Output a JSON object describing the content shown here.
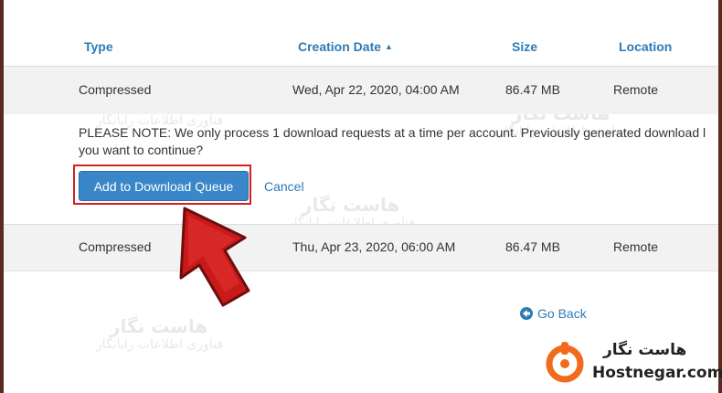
{
  "table": {
    "headers": {
      "type": "Type",
      "creation_date": "Creation Date",
      "size": "Size",
      "location": "Location"
    },
    "sort_indicator": "▲",
    "rows": [
      {
        "type": "Compressed",
        "creation_date": "Wed, Apr 22, 2020, 04:00 AM",
        "size": "86.47 MB",
        "location": "Remote"
      },
      {
        "type": "Compressed",
        "creation_date": "Thu, Apr 23, 2020, 06:00 AM",
        "size": "86.47 MB",
        "location": "Remote"
      }
    ]
  },
  "notice": {
    "line1": "PLEASE NOTE: We only process 1 download requests at a time per account. Previously generated download l",
    "line2": "you want to continue?",
    "add_button_label": "Add to Download Queue",
    "cancel_label": "Cancel"
  },
  "go_back_label": "Go Back",
  "watermark": {
    "title": "هاست نگار",
    "subtitle": "فناوری اطلاعات رایانگار"
  },
  "brand": {
    "name_fa": "هاست نگار",
    "name_en": "Hostnegar.com",
    "accent_color": "#f26a1b"
  },
  "colors": {
    "link": "#2e7bb5",
    "primary_button": "#3986c8",
    "highlight_box": "#d42020",
    "arrow": "#c81a1a"
  }
}
